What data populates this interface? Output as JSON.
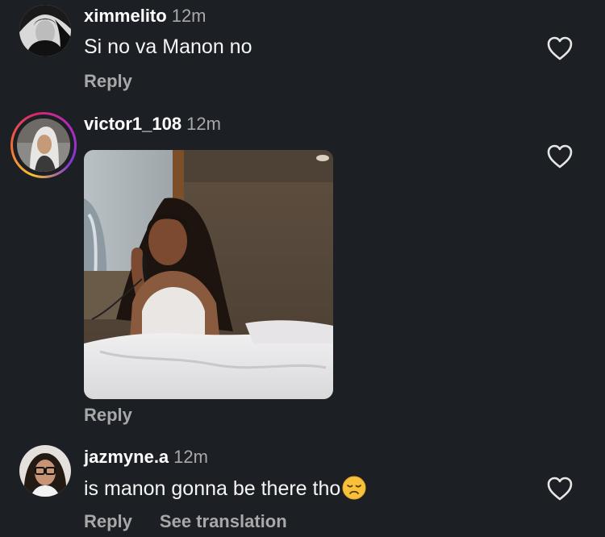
{
  "comments": [
    {
      "username": "ximmelito",
      "time": "12m",
      "text": "Si no va Manon no",
      "reply_label": "Reply",
      "has_story": false
    },
    {
      "username": "victor1_108",
      "time": "12m",
      "text": "",
      "reply_label": "Reply",
      "has_story": true,
      "media": "gif"
    },
    {
      "username": "jazmyne.a",
      "time": "12m",
      "text": "is manon gonna be there tho",
      "emoji": "disappointed-face",
      "reply_label": "Reply",
      "translate_label": "See translation",
      "has_story": false
    }
  ],
  "colors": {
    "background": "#1c1f24",
    "username": "#ffffff",
    "secondary_text": "#a8a8a8",
    "story_ring_start": "#f9c12e",
    "story_ring_end": "#b12bbf"
  },
  "icons": {
    "like": "heart-outline-icon"
  }
}
